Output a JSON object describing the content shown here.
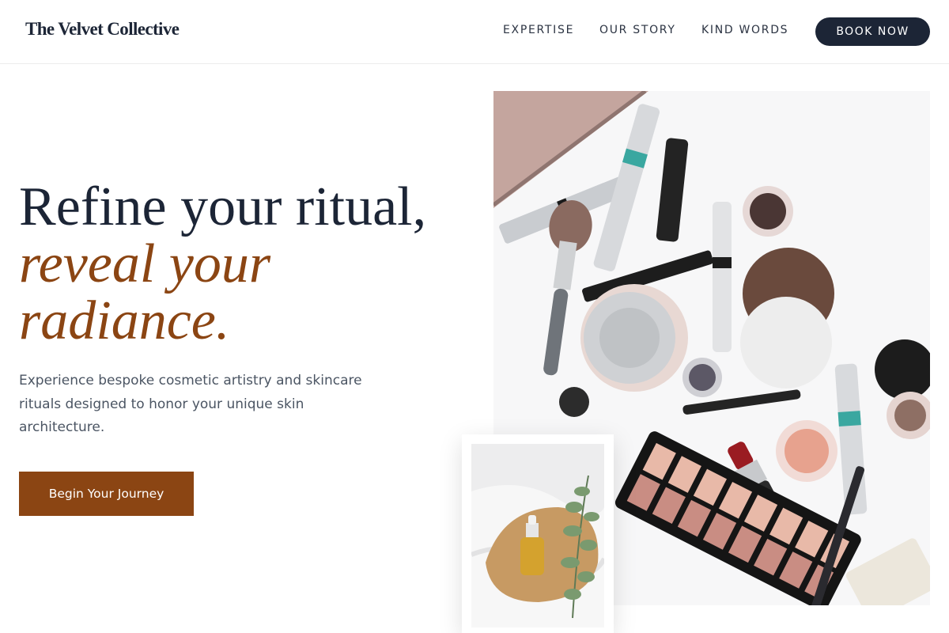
{
  "header": {
    "brand": "The Velvet Collective",
    "nav": [
      "EXPERTISE",
      "OUR STORY",
      "KIND WORDS"
    ],
    "book_label": "BOOK NOW"
  },
  "hero": {
    "headline_line1": "Refine your ritual,",
    "headline_accent_line1": "reveal your",
    "headline_accent_line2": "radiance.",
    "subtext": "Experience bespoke cosmetic artistry and skincare rituals designed to honor your unique skin architecture.",
    "cta_label": "Begin Your Journey"
  },
  "images": {
    "main": "makeup-flatlay-photo",
    "secondary": "skincare-serum-bottle-photo"
  },
  "colors": {
    "navy": "#1c2536",
    "accent_brown": "#8b4513",
    "body_text": "#4b5563"
  }
}
